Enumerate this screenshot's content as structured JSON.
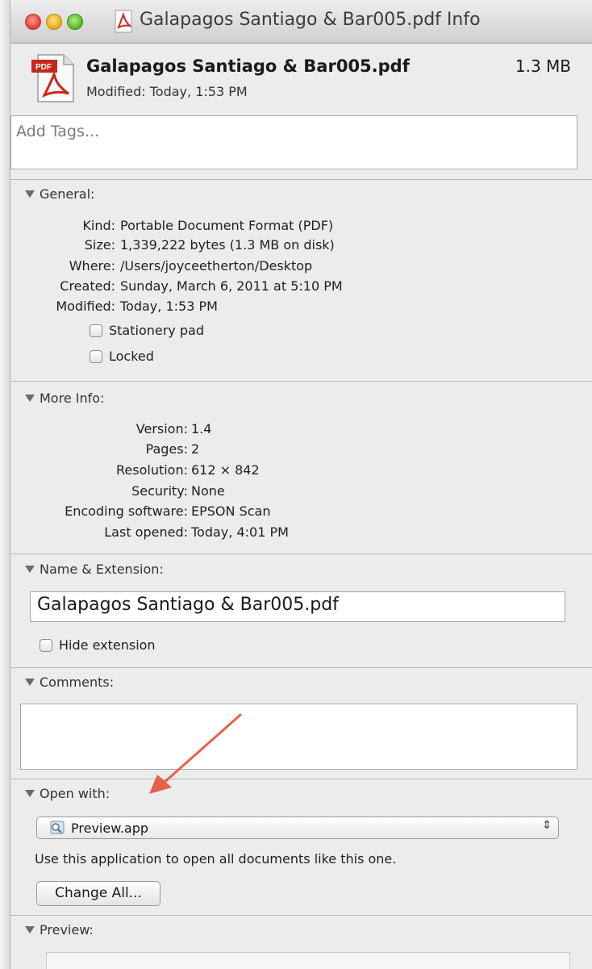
{
  "window": {
    "title": "Galapagos Santiago & Bar005.pdf Info"
  },
  "header": {
    "file_name": "Galapagos Santiago & Bar005.pdf",
    "file_size": "1.3 MB",
    "modified": "Modified: Today, 1:53 PM",
    "icon": "pdf-document-icon"
  },
  "tags": {
    "placeholder": "Add Tags..."
  },
  "general": {
    "title": "General:",
    "rows": [
      {
        "key": "Kind:",
        "value": "Portable Document Format (PDF)"
      },
      {
        "key": "Size:",
        "value": "1,339,222 bytes (1.3 MB on disk)"
      },
      {
        "key": "Where:",
        "value": "/Users/joyceetherton/Desktop"
      },
      {
        "key": "Created:",
        "value": "Sunday, March 6, 2011 at 5:10 PM"
      },
      {
        "key": "Modified:",
        "value": "Today, 1:53 PM"
      }
    ],
    "stationery_label": "Stationery pad",
    "stationery_checked": false,
    "locked_label": "Locked",
    "locked_checked": false
  },
  "more_info": {
    "title": "More Info:",
    "rows": [
      {
        "key": "Version:",
        "value": "1.4"
      },
      {
        "key": "Pages:",
        "value": "2"
      },
      {
        "key": "Resolution:",
        "value": "612 × 842"
      },
      {
        "key": "Security:",
        "value": "None"
      },
      {
        "key": "Encoding software:",
        "value": "EPSON Scan"
      },
      {
        "key": "Last opened:",
        "value": "Today, 4:01 PM"
      }
    ]
  },
  "name_extension": {
    "title": "Name & Extension:",
    "name_value": "Galapagos Santiago & Bar005.pdf",
    "hide_extension_label": "Hide extension",
    "hide_extension_checked": false
  },
  "comments": {
    "title": "Comments:",
    "value": ""
  },
  "open_with": {
    "title": "Open with:",
    "app_label": "Preview.app",
    "app_icon": "preview-app-icon",
    "description": "Use this application to open all documents like this one.",
    "change_all_label": "Change All..."
  },
  "preview": {
    "title": "Preview:"
  },
  "colors": {
    "annotation_arrow": "#e8604c",
    "close": "#e04a3c",
    "minimize": "#f0b01a",
    "zoom": "#5fbf2d"
  }
}
